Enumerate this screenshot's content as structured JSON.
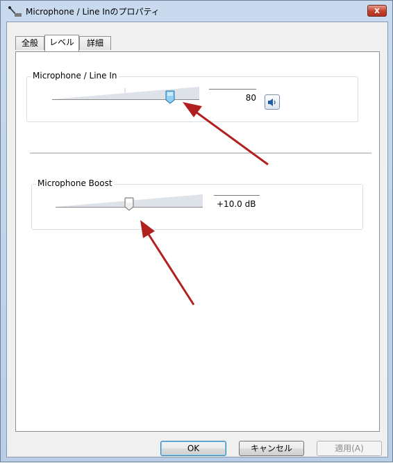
{
  "window": {
    "title": "Microphone / Line Inのプロパティ",
    "close_label": "x"
  },
  "tabs": [
    {
      "label": "全般",
      "active": false
    },
    {
      "label": "レベル",
      "active": true
    },
    {
      "label": "詳細",
      "active": false
    }
  ],
  "microphone": {
    "group_label": "Microphone / Line In",
    "value": "80",
    "level_fraction": 0.8
  },
  "boost": {
    "group_label": "Microphone Boost",
    "value": "+10.0 dB",
    "level_fraction": 0.5
  },
  "buttons": {
    "ok": "OK",
    "cancel": "キャンセル",
    "apply": "適用(A)"
  },
  "colors": {
    "arrow": "#b21f1f",
    "thumb_active": "#48a7e0",
    "close_button": "#c2412c"
  },
  "icons": {
    "title_icon": "microphone-icon",
    "speaker": "speaker-icon"
  }
}
